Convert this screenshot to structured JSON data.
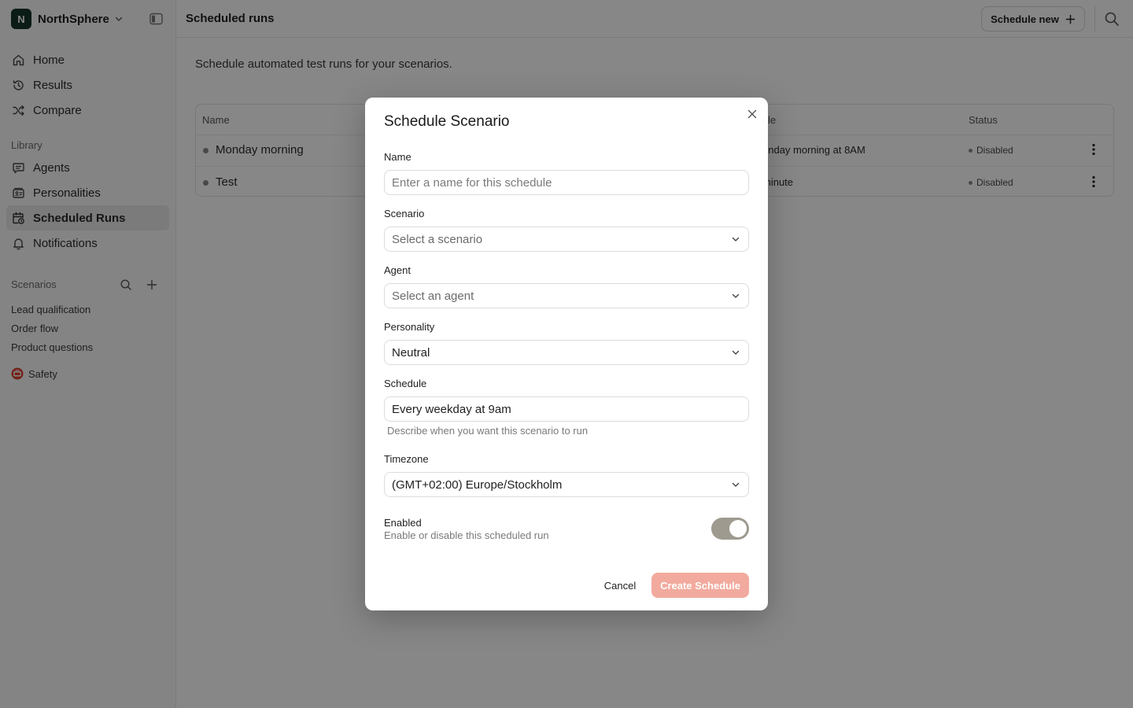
{
  "workspace": {
    "initial": "N",
    "name": "NorthSphere"
  },
  "sidebar": {
    "nav": [
      {
        "label": "Home",
        "icon": "home-icon"
      },
      {
        "label": "Results",
        "icon": "history-icon"
      },
      {
        "label": "Compare",
        "icon": "shuffle-icon"
      }
    ],
    "library_label": "Library",
    "library": [
      {
        "label": "Agents",
        "icon": "chat-icon"
      },
      {
        "label": "Personalities",
        "icon": "personalities-icon"
      },
      {
        "label": "Scheduled Runs",
        "icon": "calendar-clock-icon",
        "active": true
      },
      {
        "label": "Notifications",
        "icon": "bell-icon"
      }
    ],
    "scenarios_label": "Scenarios",
    "scenarios": [
      "Lead qualification",
      "Order flow",
      "Product questions"
    ],
    "safety_label": "Safety"
  },
  "header": {
    "title": "Scheduled runs",
    "schedule_new": "Schedule new"
  },
  "main": {
    "subtitle": "Schedule automated test runs for your scenarios.",
    "table": {
      "columns": {
        "name": "Name",
        "schedule": "le",
        "status": "Status"
      },
      "rows": [
        {
          "name": "Monday morning",
          "schedule": "onday morning at 8AM",
          "status": "Disabled"
        },
        {
          "name": "Test",
          "schedule": "minute",
          "status": "Disabled"
        }
      ]
    }
  },
  "modal": {
    "title": "Schedule Scenario",
    "name_label": "Name",
    "name_placeholder": "Enter a name for this schedule",
    "scenario_label": "Scenario",
    "scenario_value": "Select a scenario",
    "agent_label": "Agent",
    "agent_value": "Select an agent",
    "personality_label": "Personality",
    "personality_value": "Neutral",
    "schedule_label": "Schedule",
    "schedule_value": "Every weekday at 9am",
    "schedule_hint": "Describe when you want this scenario to run",
    "timezone_label": "Timezone",
    "timezone_value": "(GMT+02:00) Europe/Stockholm",
    "enabled_label": "Enabled",
    "enabled_desc": "Enable or disable this scheduled run",
    "enabled": true,
    "cancel": "Cancel",
    "create": "Create Schedule"
  },
  "colors": {
    "brand": "#16352b",
    "primary_disabled": "#f2aa9e",
    "toggle_on": "#9e9a90"
  }
}
